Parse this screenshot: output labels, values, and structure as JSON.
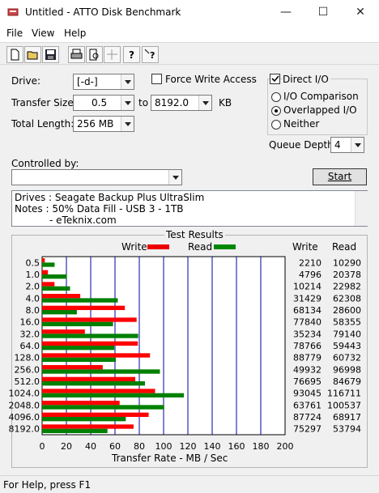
{
  "window": {
    "title": "Untitled - ATTO Disk Benchmark"
  },
  "menu": [
    "File",
    "View",
    "Help"
  ],
  "toolbar_icons": [
    "new-icon",
    "open-icon",
    "save-icon",
    "print-icon",
    "print-preview-icon",
    "move-icon",
    "help-icon",
    "context-help-icon"
  ],
  "settings": {
    "drive_label": "Drive:",
    "drive_value": "[-d-]",
    "transfer_size_label": "Transfer Size:",
    "transfer_from": "0.5",
    "to_label": "to",
    "transfer_to": "8192.0",
    "kb_label": "KB",
    "total_length_label": "Total Length:",
    "total_length_value": "256 MB",
    "force_write_label": "Force Write Access",
    "force_write_checked": false,
    "direct_io_label": "Direct I/O",
    "direct_io_checked": true,
    "io_modes": [
      {
        "label": "I/O Comparison",
        "selected": false
      },
      {
        "label": "Overlapped I/O",
        "selected": true
      },
      {
        "label": "Neither",
        "selected": false
      }
    ],
    "queue_depth_label": "Queue Depth:",
    "queue_depth_value": "4",
    "controlled_by_label": "Controlled by:",
    "controlled_by_value": "",
    "start_label": "Start"
  },
  "notes": {
    "line1": "Drives : Seagate Backup Plus UltraSlim",
    "line2": "Notes : 50% Data Fill - USB 3 - 1TB",
    "line3": "- eTeknix.com"
  },
  "results_header": "Test Results",
  "chart_data": {
    "type": "bar",
    "orientation": "horizontal",
    "title": "Test Results",
    "xlabel": "Transfer Rate - MB / Sec",
    "xlim": [
      0,
      200
    ],
    "xticks": [
      "0",
      "20",
      "40",
      "60",
      "80",
      "100",
      "120",
      "140",
      "160",
      "180",
      "200"
    ],
    "categories": [
      "0.5",
      "1.0",
      "2.0",
      "4.0",
      "8.0",
      "16.0",
      "32.0",
      "64.0",
      "128.0",
      "256.0",
      "512.0",
      "1024.0",
      "2048.0",
      "4096.0",
      "8192.0"
    ],
    "series": [
      {
        "name": "Write",
        "color": "#ff0000",
        "values": [
          2.2,
          4.8,
          10.2,
          31.4,
          68.1,
          77.8,
          35.2,
          78.8,
          88.8,
          49.9,
          76.7,
          93.0,
          63.8,
          87.7,
          75.3
        ]
      },
      {
        "name": "Read",
        "color": "#008000",
        "values": [
          10.3,
          20.4,
          23.0,
          62.3,
          28.6,
          58.4,
          79.1,
          59.4,
          60.7,
          97.0,
          84.7,
          116.7,
          100.5,
          68.9,
          53.8
        ]
      }
    ],
    "write_col_label": "Write",
    "read_col_label": "Read",
    "write_values": [
      "2210",
      "4796",
      "10214",
      "31429",
      "68134",
      "77840",
      "35234",
      "78766",
      "88779",
      "49932",
      "76695",
      "93045",
      "63761",
      "87724",
      "75297"
    ],
    "read_values": [
      "10290",
      "20378",
      "22982",
      "62308",
      "28600",
      "58355",
      "79140",
      "59443",
      "60732",
      "96998",
      "84679",
      "116711",
      "100537",
      "68917",
      "53794"
    ],
    "grid": true,
    "gridline_color": "#0000a0"
  },
  "status": "For Help, press F1"
}
